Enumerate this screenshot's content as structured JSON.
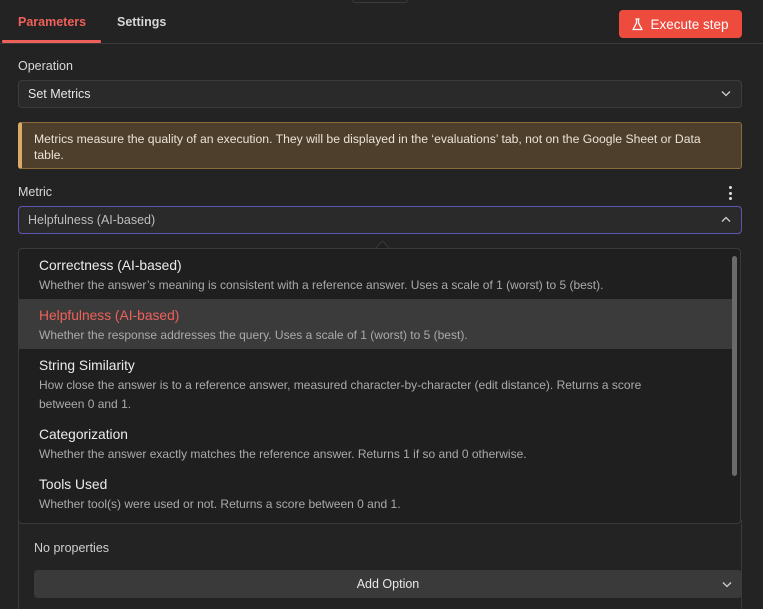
{
  "tabs": [
    {
      "label": "Parameters",
      "active": true
    },
    {
      "label": "Settings",
      "active": false
    }
  ],
  "execute_button": {
    "label": "Execute step",
    "icon": "flask-icon",
    "color": "#ee4b3f"
  },
  "accent_color": "#f0605a",
  "operation": {
    "label": "Operation",
    "value": "Set Metrics"
  },
  "notice": {
    "text": "Metrics measure the quality of an execution. They will be displayed in the ‘evaluations’ tab, not on the Google Sheet or Data table."
  },
  "metric": {
    "label": "Metric",
    "value": "Helpfulness (AI-based)",
    "menu_icon": "kebab-menu-icon"
  },
  "metric_options": [
    {
      "title": "Correctness (AI-based)",
      "desc": "Whether the answer’s meaning is consistent with a reference answer. Uses a scale of 1 (worst) to 5 (best)."
    },
    {
      "title": "Helpfulness (AI-based)",
      "desc": "Whether the response addresses the query. Uses a scale of 1 (worst) to 5 (best).",
      "highlighted": true
    },
    {
      "title": "String Similarity",
      "desc_line1": "How close the answer is to a reference answer, measured character-by-character (edit distance). Returns a score",
      "desc_line2": "between 0 and 1."
    },
    {
      "title": "Categorization",
      "desc": "Whether the answer exactly matches the reference answer. Returns 1 if so and 0 otherwise."
    },
    {
      "title": "Tools Used",
      "desc": "Whether tool(s) were used or not. Returns a score between 0 and 1."
    }
  ],
  "options": {
    "empty_text": "No properties",
    "add_label": "Add Option"
  }
}
